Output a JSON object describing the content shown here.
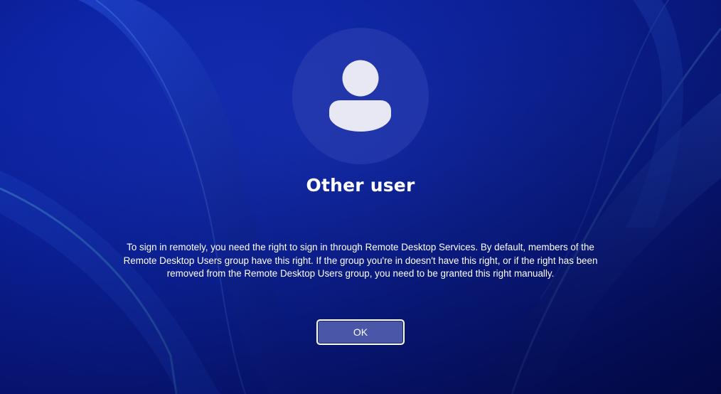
{
  "lock_screen": {
    "username": "Other user",
    "message": "To sign in remotely, you need the right to sign in through Remote Desktop Services. By default, members of the Remote Desktop Users group have this right. If the group you're in doesn't have this right, or if the right has been removed from the Remote Desktop Users group, you need to be granted this right manually.",
    "ok_label": "OK",
    "avatar_icon": "user-icon"
  },
  "colors": {
    "background": "#0a1f9a",
    "avatar_circle": "#283caf",
    "avatar_glyph": "#e8e8f4",
    "button_fill": "#4a56a8",
    "button_border": "#ffffff"
  }
}
